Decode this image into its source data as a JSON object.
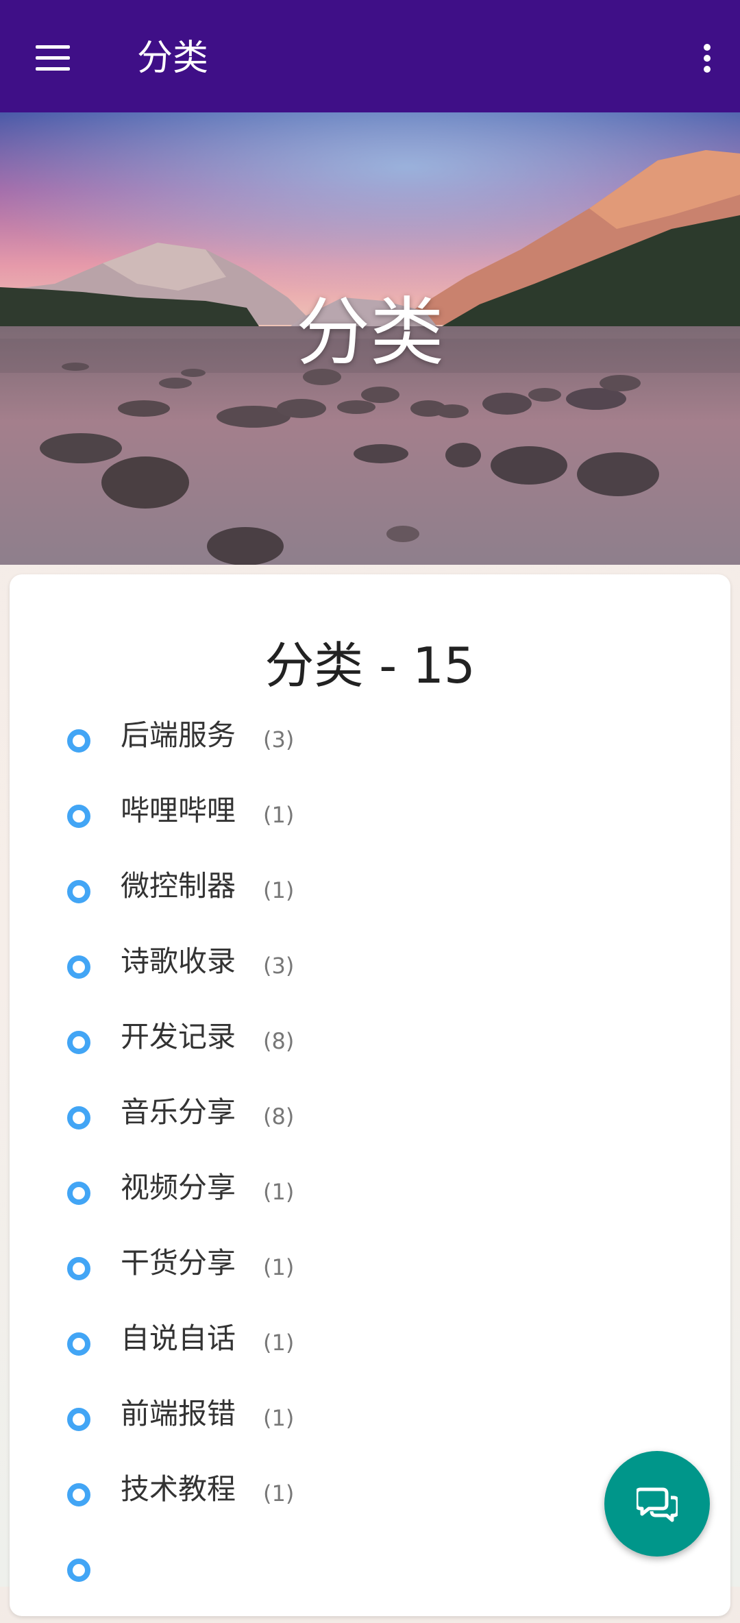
{
  "topbar": {
    "title": "分类",
    "menu_icon": "hamburger-menu-icon",
    "more_icon": "more-vertical-icon",
    "background_color": "#3f0f87"
  },
  "hero": {
    "title": "分类"
  },
  "card": {
    "title": "分类 - 15",
    "bullet_color": "#42a5f5",
    "categories": [
      {
        "name": "后端服务",
        "count": "(3)"
      },
      {
        "name": "哔哩哔哩",
        "count": "(1)"
      },
      {
        "name": "微控制器",
        "count": "(1)"
      },
      {
        "name": "诗歌收录",
        "count": "(3)"
      },
      {
        "name": "开发记录",
        "count": "(8)"
      },
      {
        "name": "音乐分享",
        "count": "(8)"
      },
      {
        "name": "视频分享",
        "count": "(1)"
      },
      {
        "name": "干货分享",
        "count": "(1)"
      },
      {
        "name": "自说自话",
        "count": "(1)"
      },
      {
        "name": "前端报错",
        "count": "(1)"
      },
      {
        "name": "技术教程",
        "count": "(1)"
      }
    ]
  },
  "fab": {
    "icon": "chat-bubbles-icon",
    "color": "#00968a"
  }
}
